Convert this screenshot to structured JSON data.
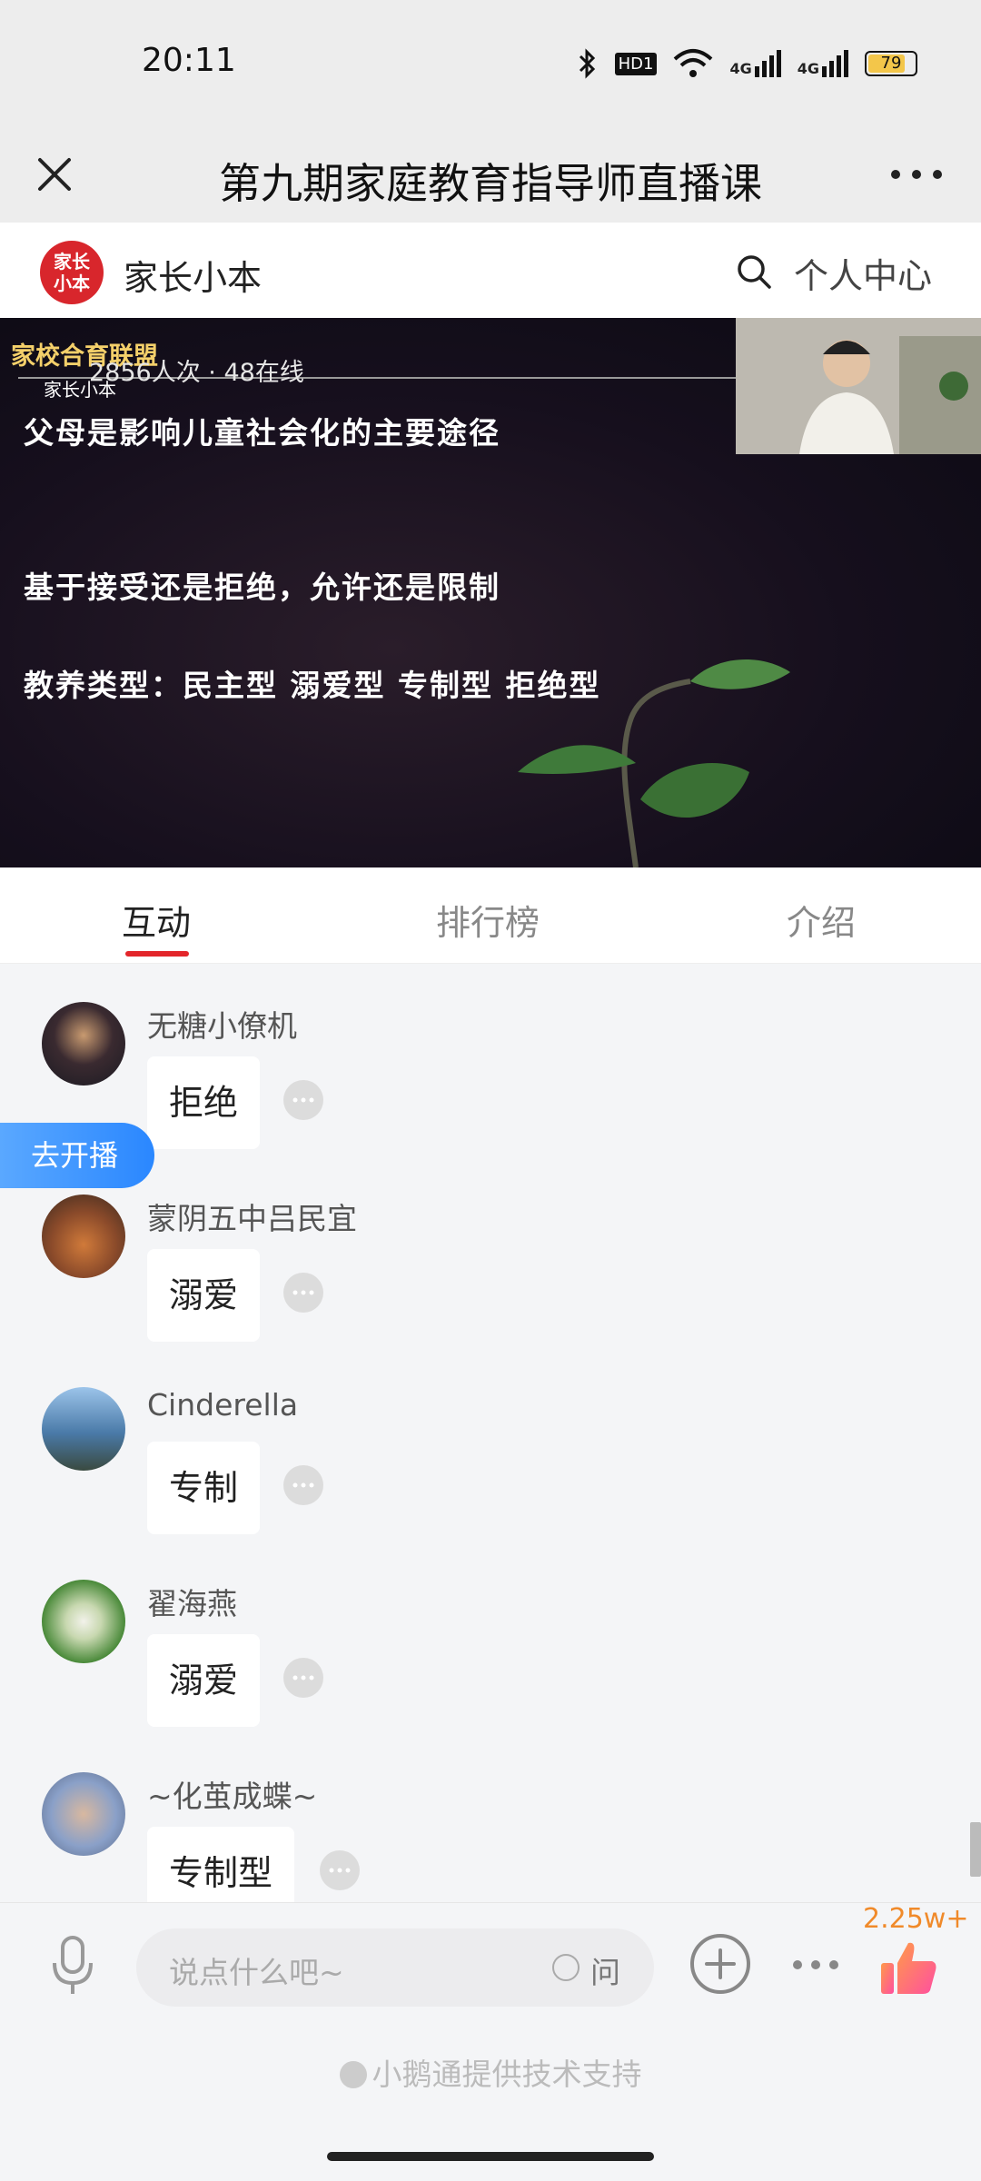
{
  "status": {
    "time": "20:11",
    "battery": "79",
    "network_1": "4G",
    "network_2": "4G",
    "hd": "HD1"
  },
  "titlebar": {
    "title": "第九期家庭教育指导师直播课"
  },
  "header": {
    "logo_text": "家长\n小本",
    "brand": "家长小本",
    "personal_center": "个人中心"
  },
  "video": {
    "watermark": "家校合育联盟",
    "watermark_sub": "家长小本",
    "viewers": "2856人次 · 48在线",
    "slide_lines": [
      "父母是影响儿童社会化的主要途径",
      "基于接受还是拒绝，允许还是限制",
      "教养类型：民主型  溺爱型  专制型  拒绝型"
    ]
  },
  "tabs": [
    {
      "label": "互动",
      "active": true
    },
    {
      "label": "排行榜",
      "active": false
    },
    {
      "label": "介绍",
      "active": false
    }
  ],
  "go_live": "去开播",
  "messages": [
    {
      "name": "无糖小僚机",
      "text": "拒绝",
      "avatar_color": "#3a2a30"
    },
    {
      "name": "蒙阴五中吕民宜",
      "text": "溺爱",
      "avatar_color": "#8a4a2a"
    },
    {
      "name": "Cinderella",
      "text": "专制",
      "avatar_color": "#4a7aa8"
    },
    {
      "name": "翟海燕",
      "text": "溺爱",
      "avatar_color": "#4a8a3a"
    },
    {
      "name": "~化茧成蝶~",
      "text": "专制型",
      "avatar_color": "#8aa0c8"
    }
  ],
  "bottom": {
    "placeholder": "说点什么吧~",
    "ask_label": "问",
    "like_count": "2.25w+",
    "support_text": "小鹅通提供技术支持"
  },
  "colors": {
    "accent": "#e3262b",
    "golive": "#2a87ff",
    "like": "#f08a2a"
  }
}
